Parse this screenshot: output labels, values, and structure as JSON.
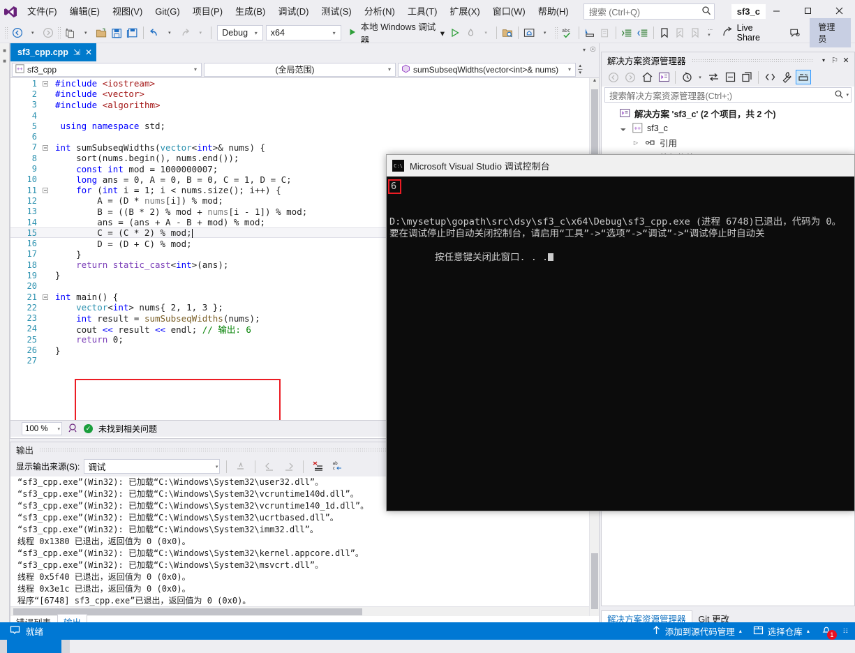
{
  "window": {
    "project_title": "sf3_c",
    "logo_name": "visual-studio-logo"
  },
  "menu": {
    "items": [
      {
        "label": "文件(F)",
        "name": "menu-file"
      },
      {
        "label": "编辑(E)",
        "name": "menu-edit"
      },
      {
        "label": "视图(V)",
        "name": "menu-view"
      },
      {
        "label": "Git(G)",
        "name": "menu-git"
      },
      {
        "label": "项目(P)",
        "name": "menu-project"
      },
      {
        "label": "生成(B)",
        "name": "menu-build"
      },
      {
        "label": "调试(D)",
        "name": "menu-debug"
      },
      {
        "label": "测试(S)",
        "name": "menu-test"
      },
      {
        "label": "分析(N)",
        "name": "menu-analyze"
      },
      {
        "label": "工具(T)",
        "name": "menu-tools"
      },
      {
        "label": "扩展(X)",
        "name": "menu-extensions"
      },
      {
        "label": "窗口(W)",
        "name": "menu-window"
      },
      {
        "label": "帮助(H)",
        "name": "menu-help"
      }
    ]
  },
  "search": {
    "placeholder": "搜索 (Ctrl+Q)",
    "value": ""
  },
  "window_controls": {
    "minimize": "─",
    "maximize": "☐",
    "close": "✕"
  },
  "toolbar": {
    "config": "Debug",
    "platform": "x64",
    "run_label": "本地 Windows 调试器",
    "live_share": "Live Share",
    "admin": "管理员",
    "arrow": "▾"
  },
  "editor": {
    "tab_label": "sf3_cpp.cpp",
    "tab_pin": "⇲",
    "tab_close": "✕",
    "nav_project": "sf3_cpp",
    "nav_scope": "(全局范围)",
    "nav_function": "sumSubseqWidths(vector<int>& nums)",
    "zoom": "100 %",
    "issue_status": "未找到相关问题",
    "lines": [
      {
        "n": "1",
        "segs": [
          {
            "t": "#include ",
            "c": "pp"
          },
          {
            "t": "<iostream>",
            "c": "str"
          }
        ],
        "fold": "minus",
        "chg": true
      },
      {
        "n": "2",
        "segs": [
          {
            "t": "#include ",
            "c": "pp"
          },
          {
            "t": "<vector>",
            "c": "str"
          }
        ],
        "chg": true
      },
      {
        "n": "3",
        "segs": [
          {
            "t": "#include ",
            "c": "pp"
          },
          {
            "t": "<algorithm>",
            "c": "str"
          }
        ],
        "chg": true
      },
      {
        "n": "4",
        "segs": [],
        "chg": true
      },
      {
        "n": "5",
        "segs": [
          {
            "t": " ",
            "c": "pl"
          },
          {
            "t": "using namespace",
            "c": "k"
          },
          {
            "t": " std;",
            "c": "pl"
          }
        ],
        "chg": true
      },
      {
        "n": "6",
        "segs": [],
        "chg": true
      },
      {
        "n": "7",
        "segs": [
          {
            "t": "int",
            "c": "k"
          },
          {
            "t": " sumSubseqWidths(",
            "c": "pl"
          },
          {
            "t": "vector",
            "c": "ty"
          },
          {
            "t": "<",
            "c": "pl"
          },
          {
            "t": "int",
            "c": "k"
          },
          {
            "t": ">& nums) {",
            "c": "pl"
          }
        ],
        "fold": "minus",
        "chg": true
      },
      {
        "n": "8",
        "segs": [
          {
            "t": "    sort(nums.begin(), nums.end());",
            "c": "pl"
          }
        ],
        "chg": true
      },
      {
        "n": "9",
        "segs": [
          {
            "t": "    ",
            "c": "pl"
          },
          {
            "t": "const int",
            "c": "k"
          },
          {
            "t": " mod = 1000000007;",
            "c": "pl"
          }
        ],
        "chg": true
      },
      {
        "n": "10",
        "segs": [
          {
            "t": "    ",
            "c": "pl"
          },
          {
            "t": "long",
            "c": "k"
          },
          {
            "t": " ans = 0, A = 0, B = 0, C = 1, D = C;",
            "c": "pl"
          }
        ],
        "chg": true
      },
      {
        "n": "11",
        "segs": [
          {
            "t": "    ",
            "c": "pl"
          },
          {
            "t": "for",
            "c": "k"
          },
          {
            "t": " (",
            "c": "pl"
          },
          {
            "t": "int",
            "c": "k"
          },
          {
            "t": " i = 1; i < nums.size(); i++) {",
            "c": "pl"
          }
        ],
        "fold": "minus",
        "chg": true
      },
      {
        "n": "12",
        "segs": [
          {
            "t": "        A = (D * ",
            "c": "pl"
          },
          {
            "t": "nums",
            "c": "dim"
          },
          {
            "t": "[i]) % mod;",
            "c": "pl"
          }
        ],
        "chg": true
      },
      {
        "n": "13",
        "segs": [
          {
            "t": "        B = ((B * 2) % mod + ",
            "c": "pl"
          },
          {
            "t": "nums",
            "c": "dim"
          },
          {
            "t": "[i - 1]) % mod;",
            "c": "pl"
          }
        ],
        "chg": true
      },
      {
        "n": "14",
        "segs": [
          {
            "t": "        ans = (ans + A - B + mod) % mod;",
            "c": "pl"
          }
        ],
        "chg": true
      },
      {
        "n": "15",
        "segs": [
          {
            "t": "        C = (C * 2) % mod;",
            "c": "pl"
          }
        ],
        "current": true,
        "chg": true
      },
      {
        "n": "16",
        "segs": [
          {
            "t": "        D = (D + C) % mod;",
            "c": "pl"
          }
        ],
        "chg": true
      },
      {
        "n": "17",
        "segs": [
          {
            "t": "    }",
            "c": "pl"
          }
        ],
        "chg": true
      },
      {
        "n": "18",
        "segs": [
          {
            "t": "    ",
            "c": "pl"
          },
          {
            "t": "return",
            "c": "kp"
          },
          {
            "t": " ",
            "c": "pl"
          },
          {
            "t": "static_cast",
            "c": "kp"
          },
          {
            "t": "<",
            "c": "pl"
          },
          {
            "t": "int",
            "c": "k"
          },
          {
            "t": ">(ans);",
            "c": "pl"
          }
        ],
        "chg": true
      },
      {
        "n": "19",
        "segs": [
          {
            "t": "}",
            "c": "pl"
          }
        ],
        "chg": true
      },
      {
        "n": "20",
        "segs": [],
        "chg": true
      },
      {
        "n": "21",
        "segs": [
          {
            "t": "int",
            "c": "k"
          },
          {
            "t": " main() {",
            "c": "pl"
          }
        ],
        "fold": "minus",
        "chg": true
      },
      {
        "n": "22",
        "segs": [
          {
            "t": "    ",
            "c": "pl"
          },
          {
            "t": "vector",
            "c": "ty"
          },
          {
            "t": "<",
            "c": "pl"
          },
          {
            "t": "int",
            "c": "k"
          },
          {
            "t": "> nums{ 2, 1, 3 };",
            "c": "pl"
          }
        ],
        "chg": true
      },
      {
        "n": "23",
        "segs": [
          {
            "t": "    ",
            "c": "pl"
          },
          {
            "t": "int",
            "c": "k"
          },
          {
            "t": " result = ",
            "c": "pl"
          },
          {
            "t": "sumSubseqWidths",
            "c": "fn"
          },
          {
            "t": "(nums);",
            "c": "pl"
          }
        ],
        "chg": true
      },
      {
        "n": "24",
        "segs": [
          {
            "t": "    cout ",
            "c": "pl"
          },
          {
            "t": "<<",
            "c": "k"
          },
          {
            "t": " result ",
            "c": "pl"
          },
          {
            "t": "<<",
            "c": "k"
          },
          {
            "t": " endl; ",
            "c": "pl"
          },
          {
            "t": "// 输出: 6",
            "c": "cm"
          }
        ],
        "chg": true
      },
      {
        "n": "25",
        "segs": [
          {
            "t": "    ",
            "c": "pl"
          },
          {
            "t": "return",
            "c": "kp"
          },
          {
            "t": " 0;",
            "c": "pl"
          }
        ],
        "chg": true
      },
      {
        "n": "26",
        "segs": [
          {
            "t": "}",
            "c": "pl"
          }
        ],
        "chg": true
      },
      {
        "n": "27",
        "segs": [],
        "chg": true
      }
    ]
  },
  "output_pane": {
    "title": "输出",
    "source_label": "显示输出来源(S):",
    "source_value": "调试",
    "lines": [
      "“sf3_cpp.exe”(Win32): 已加载“C:\\Windows\\System32\\user32.dll”。",
      "“sf3_cpp.exe”(Win32): 已加载“C:\\Windows\\System32\\vcruntime140d.dll”。",
      "“sf3_cpp.exe”(Win32): 已加载“C:\\Windows\\System32\\vcruntime140_1d.dll”。",
      "“sf3_cpp.exe”(Win32): 已加载“C:\\Windows\\System32\\ucrtbased.dll”。",
      "“sf3_cpp.exe”(Win32): 已加载“C:\\Windows\\System32\\imm32.dll”。",
      "线程 0x1380 已退出，返回值为 0 (0x0)。",
      "“sf3_cpp.exe”(Win32): 已加载“C:\\Windows\\System32\\kernel.appcore.dll”。",
      "“sf3_cpp.exe”(Win32): 已加载“C:\\Windows\\System32\\msvcrt.dll”。",
      "线程 0x5f40 已退出，返回值为 0 (0x0)。",
      "线程 0x3e1c 已退出，返回值为 0 (0x0)。",
      "程序“[6748] sf3_cpp.exe”已退出，返回值为 0 (0x0)。"
    ]
  },
  "bottom_tabs": [
    {
      "label": "错误列表",
      "active": false,
      "name": "tab-error-list"
    },
    {
      "label": "输出",
      "active": true,
      "name": "tab-output"
    }
  ],
  "solution_explorer": {
    "title": "解决方案资源管理器",
    "dropdown": "▾",
    "pin": "⚐",
    "close": "✕",
    "search_placeholder": "搜索解决方案资源管理器(Ctrl+;)",
    "tree": [
      {
        "label": "解决方案 'sf3_c' (2 个项目，共 2 个)",
        "indent": 0,
        "twisty": "",
        "icon": "solution-icon",
        "bold": true
      },
      {
        "label": "sf3_c",
        "indent": 1,
        "twisty": "◢",
        "icon": "cpp-project-icon",
        "bold": false
      },
      {
        "label": "引用",
        "indent": 2,
        "twisty": "▷",
        "icon": "references-icon",
        "bold": false
      },
      {
        "label": "外部依赖项",
        "indent": 2,
        "twisty": "▷",
        "icon": "folder-icon",
        "bold": false
      }
    ],
    "tabs": [
      {
        "label": "解决方案资源管理器",
        "active": true,
        "name": "se-tab-solution-explorer"
      },
      {
        "label": "Git 更改",
        "active": false,
        "name": "se-tab-git-changes"
      }
    ]
  },
  "console_window": {
    "title": "Microsoft Visual Studio 调试控制台",
    "output_value": "6",
    "lines": [
      "D:\\mysetup\\gopath\\src\\dsy\\sf3_c\\x64\\Debug\\sf3_cpp.exe (进程 6748)已退出，代码为 0。",
      "要在调试停止时自动关闭控制台，请启用“工具”->“选项”->“调试”->“调试停止时自动关",
      "按任意键关闭此窗口. . ."
    ]
  },
  "statusbar": {
    "ready": "就绪",
    "source_control": "添加到源代码管理",
    "repo": "选择仓库",
    "notification_count": "1",
    "caret_up": "▴"
  },
  "colors": {
    "accent": "#0078d4",
    "tab_active": "#007acc",
    "highlight_red": "#ec1c24",
    "change_bar_green": "#1e8c1e"
  }
}
